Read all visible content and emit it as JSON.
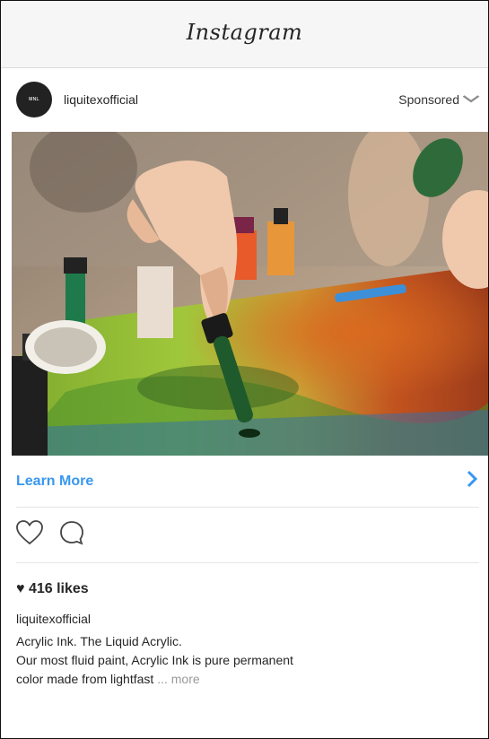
{
  "app": {
    "title": "Instagram"
  },
  "post": {
    "username": "liquitexofficial",
    "avatar_label": "MNL",
    "sponsored_label": "Sponsored",
    "cta_label": "Learn More",
    "likes": "♥ 416 likes",
    "caption_user": "liquitexofficial",
    "caption_line1": "Acrylic Ink. The Liquid Acrylic.",
    "caption_line2": "Our most fluid paint, Acrylic Ink is pure permanent",
    "caption_line3": "color made from lightfast",
    "more_label": "... more"
  },
  "colors": {
    "link": "#3897f0",
    "text": "#262626",
    "muted": "#999999"
  },
  "icons": [
    "chevron-down-icon",
    "heart-icon",
    "comment-icon",
    "chevron-right-icon"
  ]
}
